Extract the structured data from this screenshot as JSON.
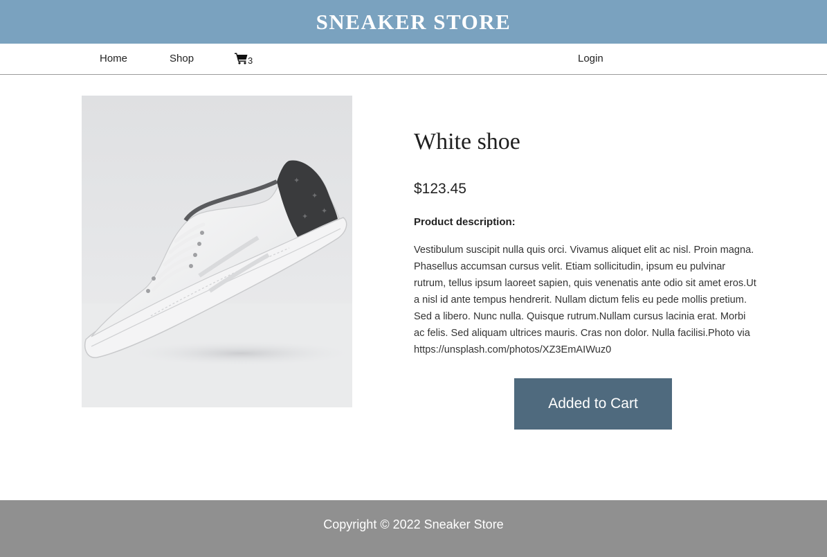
{
  "header": {
    "brand": "SNEAKER STORE"
  },
  "nav": {
    "home": "Home",
    "shop": "Shop",
    "cart_icon": "shopping-cart-icon",
    "cart_count": "3",
    "login": "Login"
  },
  "product": {
    "image_icon": "white-sneaker-photo",
    "title": "White shoe",
    "price": "$123.45",
    "description_label": "Product description:",
    "description": "Vestibulum suscipit nulla quis orci. Vivamus aliquet elit ac nisl. Proin magna. Phasellus accumsan cursus velit. Etiam sollicitudin, ipsum eu pulvinar rutrum, tellus ipsum laoreet sapien, quis venenatis ante odio sit amet eros.Ut a nisl id ante tempus hendrerit. Nullam dictum felis eu pede mollis pretium. Sed a libero. Nunc nulla. Quisque rutrum.Nullam cursus lacinia erat. Morbi ac felis. Sed aliquam ultrices mauris. Cras non dolor. Nulla facilisi.Photo via https://unsplash.com/photos/XZ3EmAIWuz0",
    "button_label": "Added to Cart"
  },
  "footer": {
    "copyright": "Copyright © 2022 Sneaker Store"
  },
  "colors": {
    "banner": "#7aa2bf",
    "button": "#4f6a7e",
    "footer": "#909090"
  }
}
